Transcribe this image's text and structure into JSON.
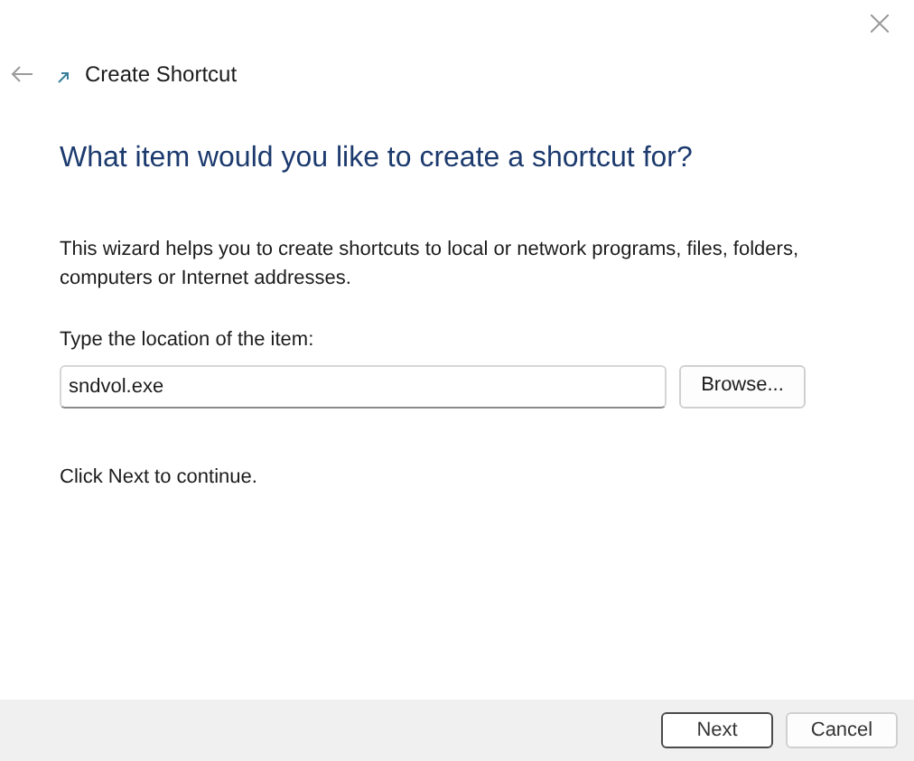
{
  "window": {
    "title": "Create Shortcut"
  },
  "heading": "What item would you like to create a shortcut for?",
  "description": "This wizard helps you to create shortcuts to local or network programs, files, folders, computers or Internet addresses.",
  "location": {
    "label": "Type the location of the item:",
    "value": "sndvol.exe",
    "browse": "Browse..."
  },
  "hint": "Click Next to continue.",
  "buttons": [
    {
      "label": "Next",
      "default": true
    },
    {
      "label": "Cancel",
      "default": false
    }
  ]
}
